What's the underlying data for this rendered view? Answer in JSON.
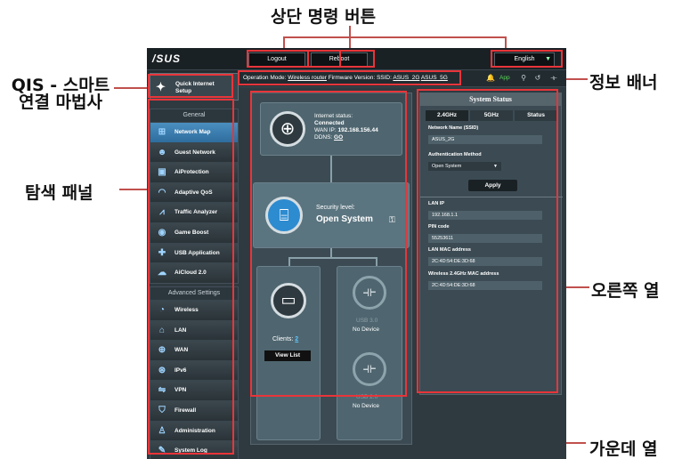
{
  "annotations": {
    "top_buttons": "상단 명령 버튼",
    "info_banner": "정보 배너",
    "qis": "QIS - 스마트\n연결 마법사",
    "qis_line1": "QIS - 스마트",
    "qis_line2": "연결 마법사",
    "nav_panel": "탐색 패널",
    "right_column": "오른쪽 열",
    "middle_column": "가운데 열"
  },
  "router": {
    "logo": "/SUS",
    "logout": "Logout",
    "reboot": "Reboot",
    "language": "English",
    "info": {
      "operation_mode_label": "Operation Mode:",
      "operation_mode": "Wireless router",
      "firmware_label": "Firmware Version:",
      "ssid_label": "SSID:",
      "ssid1": "ASUS_2G",
      "ssid2": "ASUS_5G",
      "app": "App"
    },
    "qis": {
      "line1": "Quick Internet",
      "line2": "Setup"
    },
    "nav_general_header": "General",
    "nav_general": [
      {
        "label": "Network Map",
        "icon": "network-map-icon"
      },
      {
        "label": "Guest Network",
        "icon": "guest-network-icon"
      },
      {
        "label": "AiProtection",
        "icon": "lock-icon"
      },
      {
        "label": "Adaptive QoS",
        "icon": "gauge-icon"
      },
      {
        "label": "Traffic Analyzer",
        "icon": "chart-icon"
      },
      {
        "label": "Game Boost",
        "icon": "gamepad-icon"
      },
      {
        "label": "USB Application",
        "icon": "puzzle-icon"
      },
      {
        "label": "AiCloud 2.0",
        "icon": "cloud-icon"
      }
    ],
    "nav_advanced_header": "Advanced Settings",
    "nav_advanced": [
      {
        "label": "Wireless",
        "icon": "wifi-icon"
      },
      {
        "label": "LAN",
        "icon": "home-icon"
      },
      {
        "label": "WAN",
        "icon": "globe-icon"
      },
      {
        "label": "IPv6",
        "icon": "ipv6-icon"
      },
      {
        "label": "VPN",
        "icon": "vpn-icon"
      },
      {
        "label": "Firewall",
        "icon": "shield-icon"
      },
      {
        "label": "Administration",
        "icon": "admin-icon"
      },
      {
        "label": "System Log",
        "icon": "log-icon"
      }
    ],
    "internet": {
      "status_label": "Internet status:",
      "status": "Connected",
      "wan_ip_label": "WAN IP:",
      "wan_ip": "192.168.156.44",
      "ddns_label": "DDNS:",
      "ddns": "GO"
    },
    "security": {
      "label": "Security level:",
      "value": "Open System"
    },
    "clients": {
      "label": "Clients:",
      "count": "2",
      "button": "View List"
    },
    "usb1": {
      "label": "USB 3.0",
      "status": "No Device"
    },
    "usb2": {
      "label": "USB 2.0",
      "status": "No Device"
    },
    "system_status": {
      "title": "System Status",
      "tabs": [
        "2.4GHz",
        "5GHz",
        "Status"
      ],
      "ssid_label": "Network Name (SSID)",
      "ssid_value": "ASUS_2G",
      "auth_label": "Authentication Method",
      "auth_value": "Open System",
      "apply": "Apply",
      "lan_ip_label": "LAN IP",
      "lan_ip": "192.168.1.1",
      "pin_label": "PIN code",
      "pin": "55253611",
      "lan_mac_label": "LAN MAC address",
      "lan_mac": "2C:4D:54:DE:3D:68",
      "wl_mac_label": "Wireless 2.4GHz MAC address",
      "wl_mac": "2C:4D:54:DE:3D:68"
    }
  }
}
